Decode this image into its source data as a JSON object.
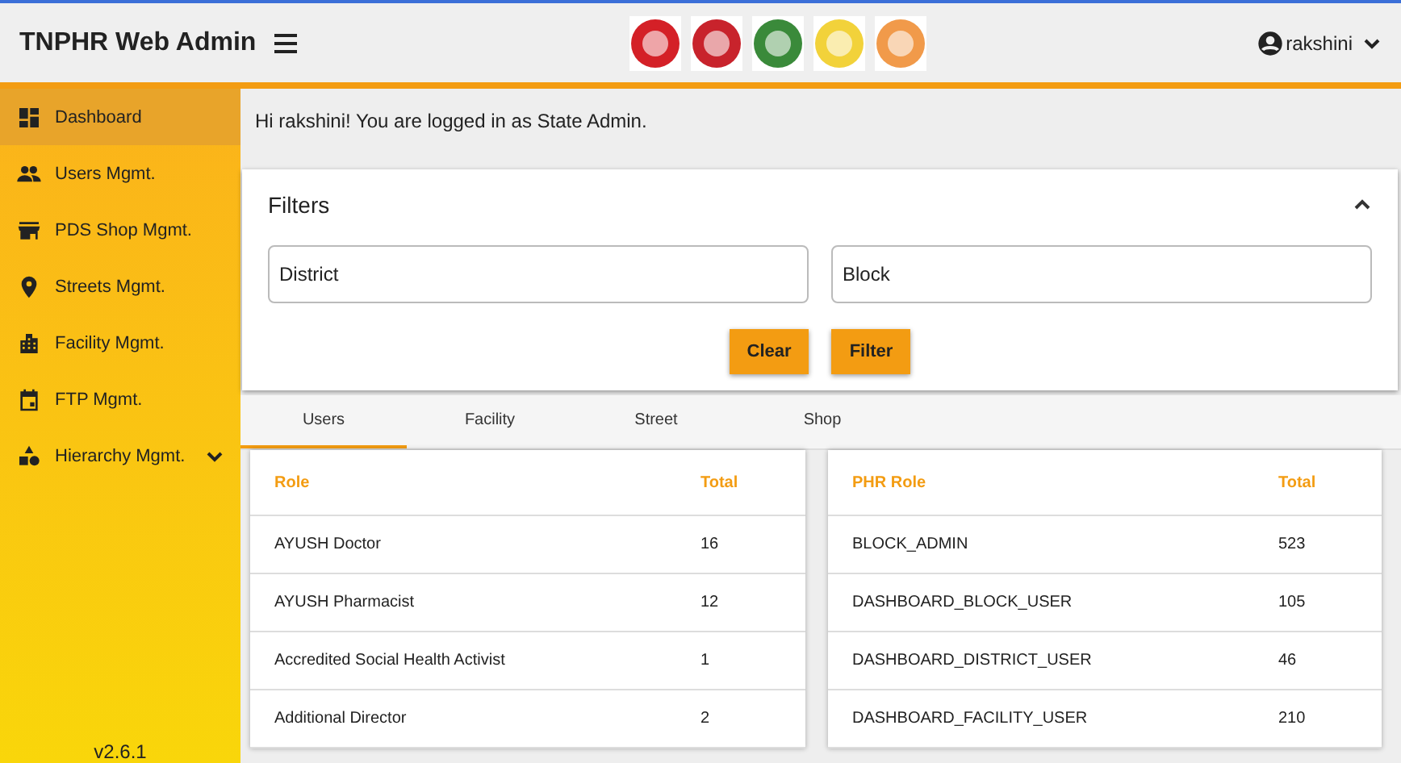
{
  "header": {
    "title": "TNPHR Web Admin",
    "user": "rakshini"
  },
  "sidebar": {
    "items": [
      {
        "label": "Dashboard",
        "selected": true,
        "expandable": false
      },
      {
        "label": "Users Mgmt.",
        "selected": false,
        "expandable": false
      },
      {
        "label": "PDS Shop Mgmt.",
        "selected": false,
        "expandable": false
      },
      {
        "label": "Streets Mgmt.",
        "selected": false,
        "expandable": false
      },
      {
        "label": "Facility Mgmt.",
        "selected": false,
        "expandable": false
      },
      {
        "label": "FTP Mgmt.",
        "selected": false,
        "expandable": false
      },
      {
        "label": "Hierarchy Mgmt.",
        "selected": false,
        "expandable": true
      }
    ],
    "version": "v2.6.1"
  },
  "greeting": "Hi rakshini! You are logged in as State Admin.",
  "filters": {
    "title": "Filters",
    "expanded": true,
    "fields": [
      {
        "placeholder": "District"
      },
      {
        "placeholder": "Block"
      }
    ],
    "buttons": [
      "Clear",
      "Filter"
    ]
  },
  "tabs": [
    {
      "label": "Users",
      "selected": true
    },
    {
      "label": "Facility",
      "selected": false
    },
    {
      "label": "Street",
      "selected": false
    },
    {
      "label": "Shop",
      "selected": false
    }
  ],
  "tables": [
    {
      "columns": [
        "Role",
        "Total"
      ],
      "rows": [
        [
          "AYUSH Doctor",
          "16"
        ],
        [
          "AYUSH Pharmacist",
          "12"
        ],
        [
          "Accredited Social Health Activist",
          "1"
        ],
        [
          "Additional Director",
          "2"
        ]
      ]
    },
    {
      "columns": [
        "PHR Role",
        "Total"
      ],
      "rows": [
        [
          "BLOCK_ADMIN",
          "523"
        ],
        [
          "DASHBOARD_BLOCK_USER",
          "105"
        ],
        [
          "DASHBOARD_DISTRICT_USER",
          "46"
        ],
        [
          "DASHBOARD_FACILITY_USER",
          "210"
        ]
      ]
    }
  ]
}
